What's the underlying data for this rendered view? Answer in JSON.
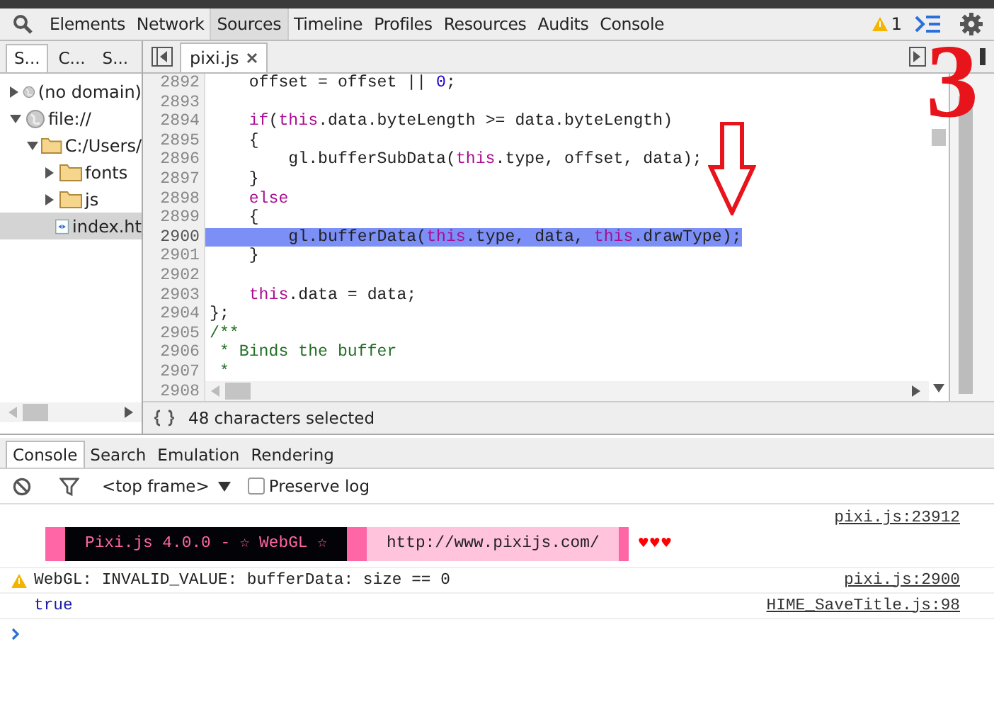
{
  "toolbar": {
    "tabs": [
      {
        "label": "Elements",
        "selected": false
      },
      {
        "label": "Network",
        "selected": false
      },
      {
        "label": "Sources",
        "selected": true
      },
      {
        "label": "Timeline",
        "selected": false
      },
      {
        "label": "Profiles",
        "selected": false
      },
      {
        "label": "Resources",
        "selected": false
      },
      {
        "label": "Audits",
        "selected": false
      },
      {
        "label": "Console",
        "selected": false
      }
    ],
    "warning_count": "1"
  },
  "navigator": {
    "tabs": [
      {
        "label": "S...",
        "selected": true
      },
      {
        "label": "C...",
        "selected": false
      },
      {
        "label": "S...",
        "selected": false
      }
    ],
    "tree": [
      {
        "label": "(no domain)",
        "kind": "domain",
        "expanded": false,
        "selected": false
      },
      {
        "label": "file://",
        "kind": "domain",
        "expanded": true,
        "selected": false,
        "children": [
          {
            "label": "C:/Users/",
            "kind": "folder",
            "expanded": true,
            "selected": false,
            "children": [
              {
                "label": "fonts",
                "kind": "folder",
                "expanded": false,
                "selected": false
              },
              {
                "label": "js",
                "kind": "folder",
                "expanded": false,
                "selected": false
              },
              {
                "label": "index.ht",
                "kind": "file",
                "selected": true
              }
            ]
          }
        ]
      }
    ]
  },
  "editor": {
    "file_tab": "pixi.js",
    "lines": [
      {
        "number": "2892",
        "highlighted": false,
        "tokens": [
          {
            "text": "    offset = offset || ",
            "kind": "plain"
          },
          {
            "text": "0",
            "kind": "number"
          },
          {
            "text": ";",
            "kind": "plain"
          }
        ]
      },
      {
        "number": "2893",
        "highlighted": false
      },
      {
        "number": "2894",
        "highlighted": false,
        "tokens": [
          {
            "text": "    if",
            "kind": "keyword"
          },
          {
            "text": "(",
            "kind": "plain"
          },
          {
            "text": "this",
            "kind": "keyword"
          },
          {
            "text": ".data.byteLength >= data.byteLength)",
            "kind": "plain"
          }
        ]
      },
      {
        "number": "2895",
        "highlighted": false,
        "tokens": [
          {
            "text": "    {",
            "kind": "plain"
          }
        ]
      },
      {
        "number": "2896",
        "highlighted": false,
        "tokens": [
          {
            "text": "        gl.bufferSubData(",
            "kind": "plain"
          },
          {
            "text": "this",
            "kind": "keyword"
          },
          {
            "text": ".type, offset, data);",
            "kind": "plain"
          }
        ]
      },
      {
        "number": "2897",
        "highlighted": false,
        "tokens": [
          {
            "text": "    }",
            "kind": "plain"
          }
        ]
      },
      {
        "number": "2898",
        "highlighted": false,
        "tokens": [
          {
            "text": "    else",
            "kind": "keyword"
          }
        ]
      },
      {
        "number": "2899",
        "highlighted": false,
        "tokens": [
          {
            "text": "    {",
            "kind": "plain"
          }
        ]
      },
      {
        "number": "2900",
        "highlighted": true,
        "tokens": [
          {
            "text": "        gl.bufferData(",
            "kind": "plain"
          },
          {
            "text": "this",
            "kind": "keyword"
          },
          {
            "text": ".type, data, ",
            "kind": "plain"
          },
          {
            "text": "this",
            "kind": "keyword"
          },
          {
            "text": ".drawType);",
            "kind": "plain"
          }
        ]
      },
      {
        "number": "2901",
        "highlighted": false,
        "tokens": [
          {
            "text": "    }",
            "kind": "plain"
          }
        ]
      },
      {
        "number": "2902",
        "highlighted": false
      },
      {
        "number": "2903",
        "highlighted": false,
        "tokens": [
          {
            "text": "    this",
            "kind": "keyword"
          },
          {
            "text": ".data = data;",
            "kind": "plain"
          }
        ]
      },
      {
        "number": "2904",
        "highlighted": false,
        "tokens": [
          {
            "text": "};",
            "kind": "plain"
          }
        ]
      },
      {
        "number": "2905",
        "highlighted": false,
        "tokens": [
          {
            "text": "/**",
            "kind": "comment"
          }
        ]
      },
      {
        "number": "2906",
        "highlighted": false,
        "tokens": [
          {
            "text": " * Binds the buffer",
            "kind": "comment"
          }
        ]
      },
      {
        "number": "2907",
        "highlighted": false,
        "tokens": [
          {
            "text": " *",
            "kind": "comment"
          }
        ]
      },
      {
        "number": "2908",
        "highlighted": false
      }
    ],
    "status": "48 characters selected"
  },
  "drawer": {
    "tabs": [
      {
        "label": "Console",
        "selected": true
      },
      {
        "label": "Search",
        "selected": false
      },
      {
        "label": "Emulation",
        "selected": false
      },
      {
        "label": "Rendering",
        "selected": false
      }
    ],
    "frame": "<top frame>",
    "preserve_log": {
      "label": "Preserve log",
      "checked": false
    },
    "messages": [
      {
        "kind": "banner",
        "parts": [
          "Pixi.js 4.0.0 - ☆ WebGL ☆",
          "http://www.pixijs.com/",
          "♥♥♥"
        ],
        "source": "pixi.js:23912"
      },
      {
        "kind": "warning",
        "text": "WebGL: INVALID_VALUE: bufferData: size == 0",
        "source": "pixi.js:2900"
      },
      {
        "kind": "result",
        "text": "true",
        "source": "HIME_SaveTitle.js:98"
      }
    ]
  },
  "annotation": {
    "text": "3"
  }
}
